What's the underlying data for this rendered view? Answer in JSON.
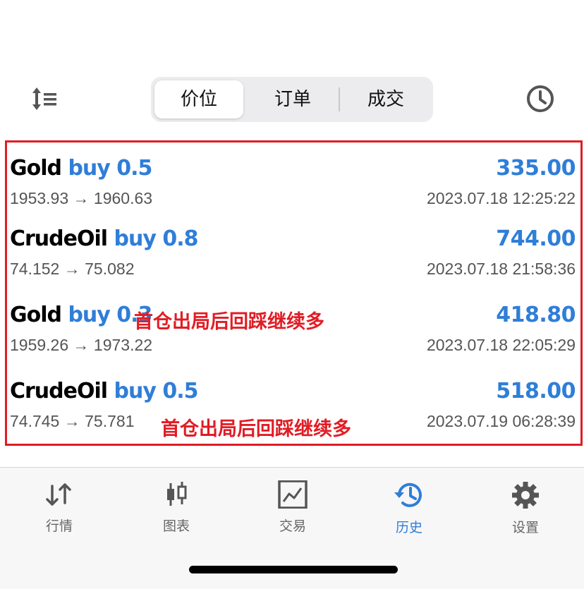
{
  "header": {
    "segments": [
      "价位",
      "订单",
      "成交"
    ],
    "active_segment": 0,
    "icons": {
      "sort": "sort-list-icon",
      "history": "clock-icon"
    }
  },
  "trades": [
    {
      "symbol": "Gold",
      "side": "buy 0.5",
      "profit": "335.00",
      "open_price": "1953.93",
      "close_price": "1960.63",
      "time": "2023.07.18 12:25:22",
      "note": ""
    },
    {
      "symbol": "CrudeOil",
      "side": "buy 0.8",
      "profit": "744.00",
      "open_price": "74.152",
      "close_price": "75.082",
      "time": "2023.07.18 21:58:36",
      "note": ""
    },
    {
      "symbol": "Gold",
      "side": "buy 0.3",
      "profit": "418.80",
      "open_price": "1959.26",
      "close_price": "1973.22",
      "time": "2023.07.18 22:05:29",
      "note": "首仓出局后回踩继续多"
    },
    {
      "symbol": "CrudeOil",
      "side": "buy 0.5",
      "profit": "518.00",
      "open_price": "74.745",
      "close_price": "75.781",
      "time": "2023.07.19 06:28:39",
      "note": "首仓出局后回踩继续多"
    }
  ],
  "arrow": "→",
  "tabbar": {
    "tabs": [
      {
        "label": "行情",
        "icon": "quotes-arrows-icon"
      },
      {
        "label": "图表",
        "icon": "candlestick-icon"
      },
      {
        "label": "交易",
        "icon": "trade-chart-icon"
      },
      {
        "label": "历史",
        "icon": "history-icon"
      },
      {
        "label": "设置",
        "icon": "gear-icon"
      }
    ],
    "active_tab": 3
  },
  "colors": {
    "accent": "#2f7ed8",
    "annotation": "#e11c24",
    "muted": "#555555"
  }
}
